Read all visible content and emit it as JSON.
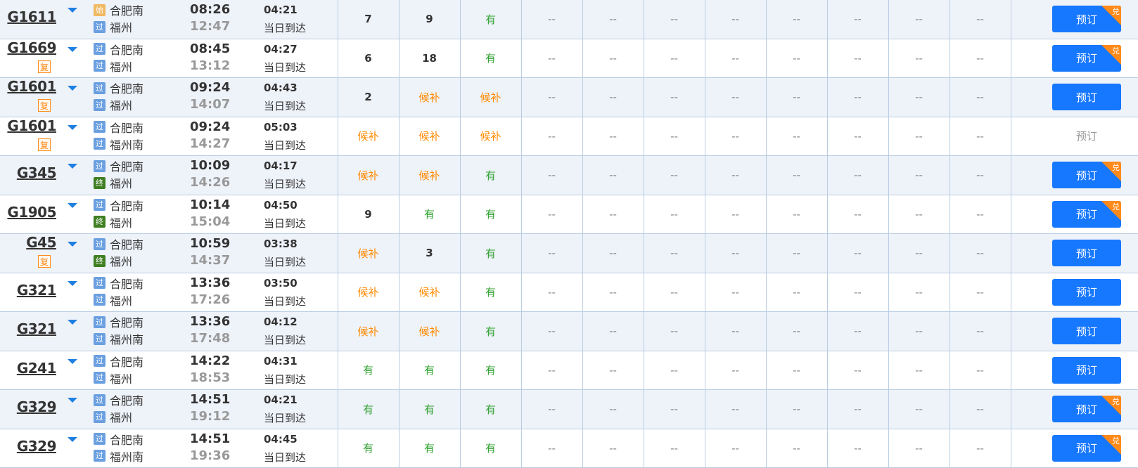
{
  "rows": [
    {
      "train": "G1611",
      "fu": false,
      "from_icon": "始",
      "from": "合肥南",
      "to_icon": "过",
      "to": "福州",
      "dep": "08:26",
      "arr": "12:47",
      "duration": "04:21",
      "arrive_day": "当日到达",
      "seats": [
        "7",
        "9",
        "有"
      ],
      "book": "预订",
      "book_enabled": true,
      "dui": true
    },
    {
      "train": "G1669",
      "fu": true,
      "from_icon": "过",
      "from": "合肥南",
      "to_icon": "过",
      "to": "福州",
      "dep": "08:45",
      "arr": "13:12",
      "duration": "04:27",
      "arrive_day": "当日到达",
      "seats": [
        "6",
        "18",
        "有"
      ],
      "book": "预订",
      "book_enabled": true,
      "dui": true
    },
    {
      "train": "G1601",
      "fu": true,
      "from_icon": "过",
      "from": "合肥南",
      "to_icon": "过",
      "to": "福州",
      "dep": "09:24",
      "arr": "14:07",
      "duration": "04:43",
      "arrive_day": "当日到达",
      "seats": [
        "2",
        "候补",
        "候补"
      ],
      "book": "预订",
      "book_enabled": true,
      "dui": false
    },
    {
      "train": "G1601",
      "fu": true,
      "from_icon": "过",
      "from": "合肥南",
      "to_icon": "过",
      "to": "福州南",
      "dep": "09:24",
      "arr": "14:27",
      "duration": "05:03",
      "arrive_day": "当日到达",
      "seats": [
        "候补",
        "候补",
        "候补"
      ],
      "book": "预订",
      "book_enabled": false,
      "dui": false
    },
    {
      "train": "G345",
      "fu": false,
      "from_icon": "过",
      "from": "合肥南",
      "to_icon": "终",
      "to": "福州",
      "dep": "10:09",
      "arr": "14:26",
      "duration": "04:17",
      "arrive_day": "当日到达",
      "seats": [
        "候补",
        "候补",
        "有"
      ],
      "book": "预订",
      "book_enabled": true,
      "dui": true
    },
    {
      "train": "G1905",
      "fu": false,
      "from_icon": "过",
      "from": "合肥南",
      "to_icon": "终",
      "to": "福州",
      "dep": "10:14",
      "arr": "15:04",
      "duration": "04:50",
      "arrive_day": "当日到达",
      "seats": [
        "9",
        "有",
        "有"
      ],
      "book": "预订",
      "book_enabled": true,
      "dui": true
    },
    {
      "train": "G45",
      "fu": true,
      "from_icon": "过",
      "from": "合肥南",
      "to_icon": "终",
      "to": "福州",
      "dep": "10:59",
      "arr": "14:37",
      "duration": "03:38",
      "arrive_day": "当日到达",
      "seats": [
        "候补",
        "3",
        "有"
      ],
      "book": "预订",
      "book_enabled": true,
      "dui": false
    },
    {
      "train": "G321",
      "fu": false,
      "from_icon": "过",
      "from": "合肥南",
      "to_icon": "过",
      "to": "福州",
      "dep": "13:36",
      "arr": "17:26",
      "duration": "03:50",
      "arrive_day": "当日到达",
      "seats": [
        "候补",
        "候补",
        "有"
      ],
      "book": "预订",
      "book_enabled": true,
      "dui": false
    },
    {
      "train": "G321",
      "fu": false,
      "from_icon": "过",
      "from": "合肥南",
      "to_icon": "过",
      "to": "福州南",
      "dep": "13:36",
      "arr": "17:48",
      "duration": "04:12",
      "arrive_day": "当日到达",
      "seats": [
        "候补",
        "候补",
        "有"
      ],
      "book": "预订",
      "book_enabled": true,
      "dui": false
    },
    {
      "train": "G241",
      "fu": false,
      "from_icon": "过",
      "from": "合肥南",
      "to_icon": "过",
      "to": "福州",
      "dep": "14:22",
      "arr": "18:53",
      "duration": "04:31",
      "arrive_day": "当日到达",
      "seats": [
        "有",
        "有",
        "有"
      ],
      "book": "预订",
      "book_enabled": true,
      "dui": false
    },
    {
      "train": "G329",
      "fu": false,
      "from_icon": "过",
      "from": "合肥南",
      "to_icon": "过",
      "to": "福州",
      "dep": "14:51",
      "arr": "19:12",
      "duration": "04:21",
      "arrive_day": "当日到达",
      "seats": [
        "有",
        "有",
        "有"
      ],
      "book": "预订",
      "book_enabled": true,
      "dui": true
    },
    {
      "train": "G329",
      "fu": false,
      "from_icon": "过",
      "from": "合肥南",
      "to_icon": "过",
      "to": "福州南",
      "dep": "14:51",
      "arr": "19:36",
      "duration": "04:45",
      "arrive_day": "当日到达",
      "seats": [
        "有",
        "有",
        "有"
      ],
      "book": "预订",
      "book_enabled": true,
      "dui": true
    }
  ],
  "empty_seat_text": "--",
  "fu_label": "复",
  "dui_label": "兑",
  "icons": {
    "始": "start-station-icon",
    "过": "pass-station-icon",
    "终": "terminal-station-icon"
  },
  "colors": {
    "accent": "#1677ff",
    "available": "#2fa12f",
    "waitlist": "#ff8a00",
    "row_alt": "#eef2f9"
  }
}
